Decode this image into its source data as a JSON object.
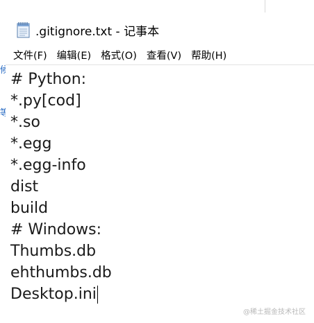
{
  "window": {
    "title": ".gitignore.txt - 记事本",
    "icon": "notepad-icon"
  },
  "menu": [
    {
      "label": "文件(F)"
    },
    {
      "label": "编辑(E)"
    },
    {
      "label": "格式(O)"
    },
    {
      "label": "查看(V)"
    },
    {
      "label": "帮助(H)"
    }
  ],
  "editor": {
    "lines": [
      "# Python:",
      "*.py[cod]",
      "*.so",
      "*.egg",
      "*.egg-info",
      "dist",
      "build",
      "# Windows:",
      "Thumbs.db",
      "ehthumbs.db",
      "Desktop.ini"
    ]
  },
  "background": {
    "fragment_1": "候",
    "fragment_2": "等"
  },
  "watermark": "@稀土掘金技术社区"
}
